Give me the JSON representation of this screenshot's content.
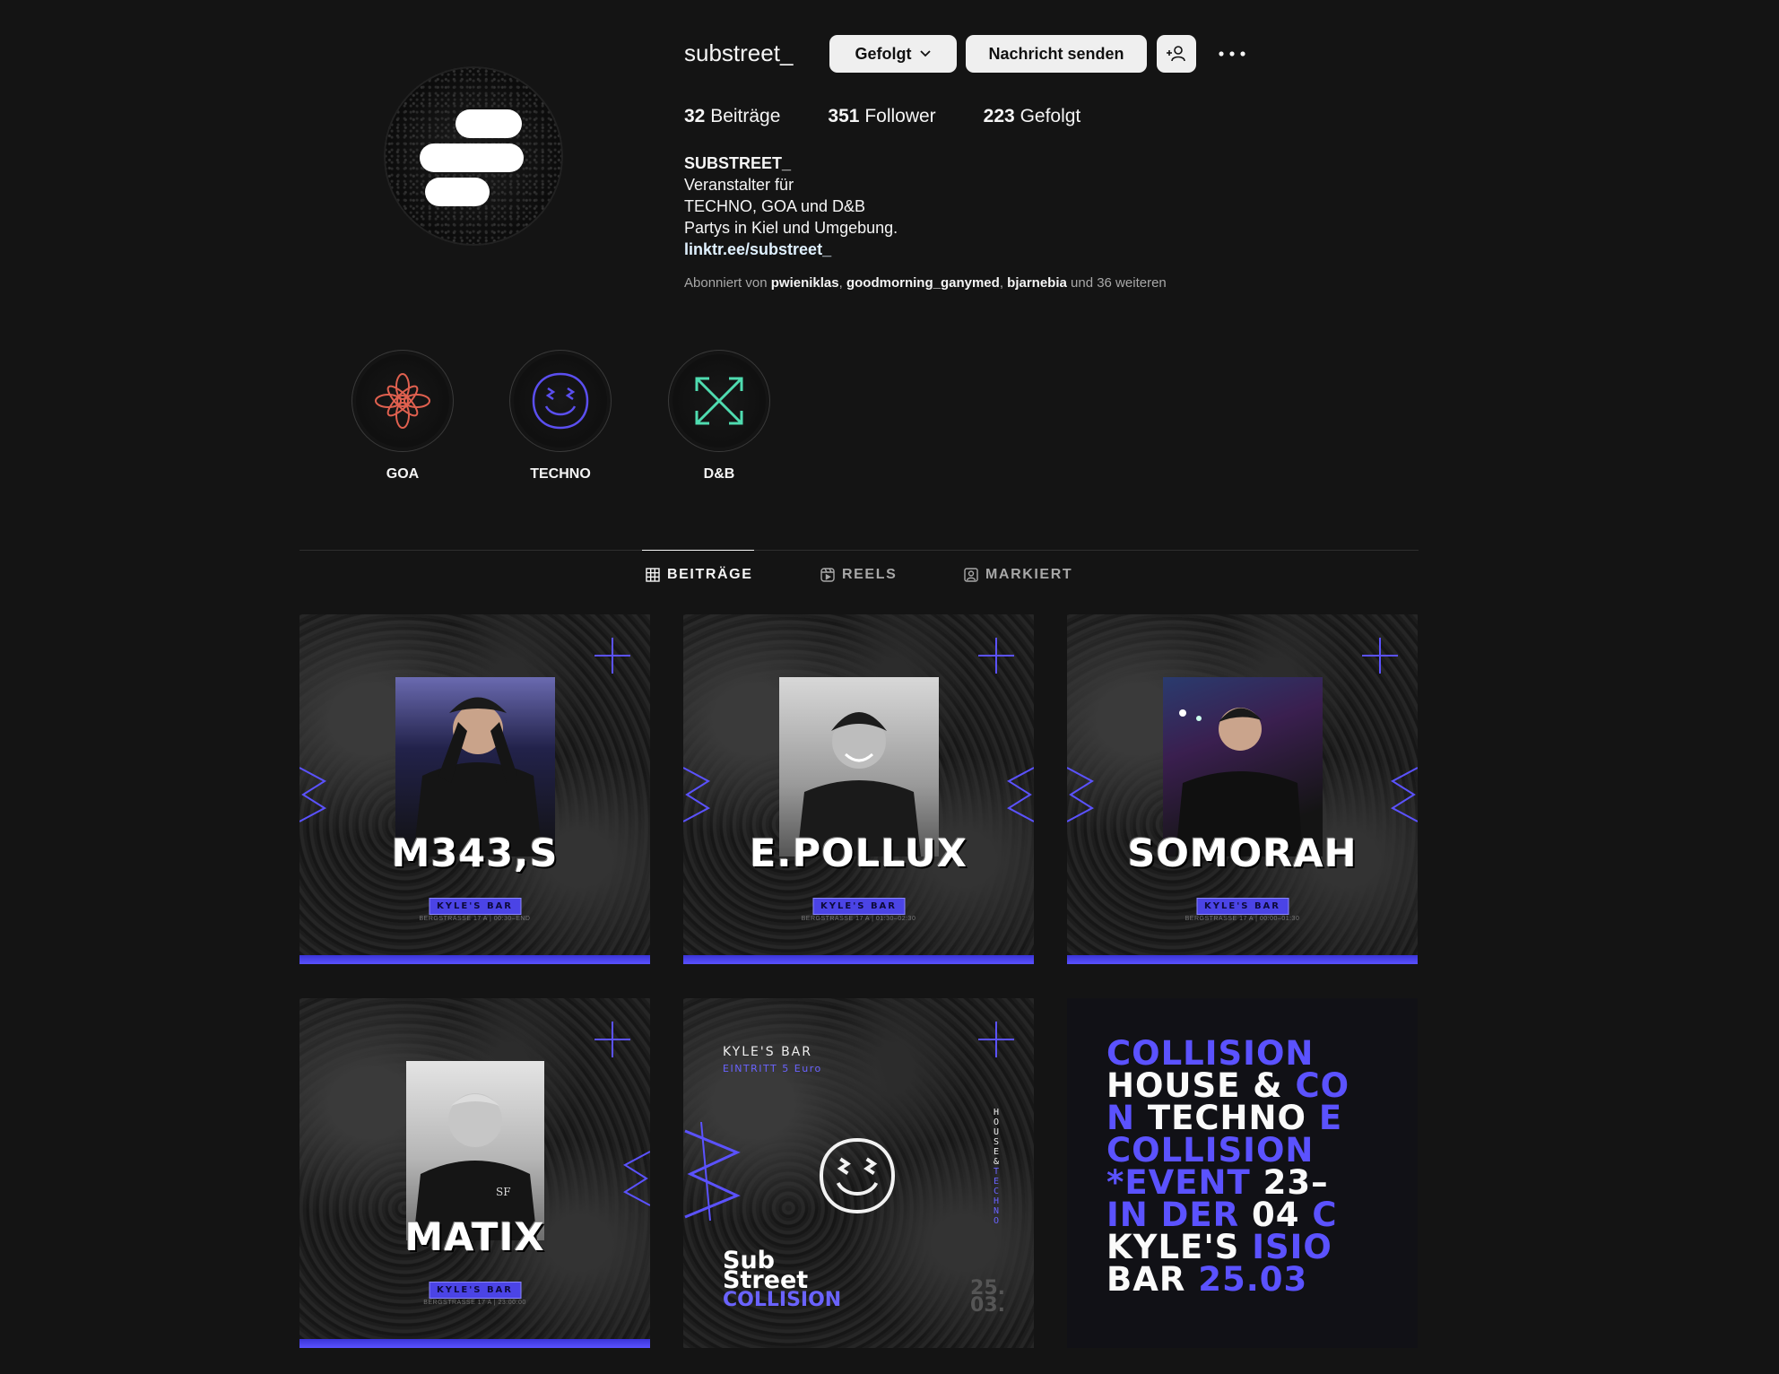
{
  "profile": {
    "username": "substreet_",
    "follow_label": "Gefolgt",
    "message_label": "Nachricht senden",
    "stats": {
      "posts_count": "32",
      "posts_label": "Beiträge",
      "followers_count": "351",
      "followers_label": "Follower",
      "following_count": "223",
      "following_label": "Gefolgt"
    },
    "bio": {
      "name": "SUBSTREET_",
      "line1": "Veranstalter für",
      "line2": "TECHNO, GOA und D&B",
      "line3": "Partys in Kiel und Umgebung.",
      "link": "linktr.ee/substreet_"
    },
    "followed_by": {
      "prefix": "Abonniert von",
      "user1": "pwieniklas",
      "user2": "goodmorning_ganymed",
      "user3": "bjarnebia",
      "suffix": "und 36 weiteren"
    }
  },
  "highlights": [
    {
      "label": "GOA",
      "icon": "mandala-icon",
      "color": "#e0604f"
    },
    {
      "label": "TECHNO",
      "icon": "smiley-icon",
      "color": "#5b4ff0"
    },
    {
      "label": "D&B",
      "icon": "arrows-icon",
      "color": "#4fdcb0"
    }
  ],
  "tabs": [
    {
      "label": "BEITRÄGE",
      "icon": "grid-icon",
      "active": true
    },
    {
      "label": "REELS",
      "icon": "reels-icon",
      "active": false
    },
    {
      "label": "MARKIERT",
      "icon": "tagged-icon",
      "active": false
    }
  ],
  "posts": [
    {
      "artist": "M343,S",
      "venue": "KYLE'S BAR",
      "address": "BERGSTRASSE 17 A  |  00:30–END"
    },
    {
      "artist": "E.POLLUX",
      "venue": "KYLE'S BAR",
      "address": "BERGSTRASSE 17 A  |  01:30–02:30"
    },
    {
      "artist": "SOMORAH",
      "venue": "KYLE'S BAR",
      "address": "BERGSTRASSE 17 A  |  00:00–01:30"
    },
    {
      "artist": "MATIX",
      "venue": "KYLE'S BAR",
      "address": "BERGSTRASSE 17 A  |  23:00:00"
    }
  ],
  "post5": {
    "venue": "KYLE'S BAR",
    "entry": "EINTRITT 5 Euro",
    "vertical_white": "HOUSE&",
    "vertical_accent": "TECHNO",
    "title1": "Sub",
    "title2": "Street",
    "title3": "COLLISION",
    "date1": "25.",
    "date2": "03."
  },
  "post6": {
    "line1": "COLLISION",
    "line2a": "HOUSE &",
    "line2b": "CO",
    "line3a": "N",
    "line3b": "TECHNO",
    "line3c": "E",
    "line4": "COLLISION",
    "line5a": "*EVENT",
    "line5b": "23–",
    "line6a": "IN DER",
    "line6b": "04",
    "line6c": "C",
    "line7a": "KYLE'S",
    "line7b": "ISIO",
    "line8a": "BAR",
    "line8b": "25.03"
  },
  "colors": {
    "background": "#141414",
    "accent": "#5b52ff",
    "button": "#efefef"
  }
}
